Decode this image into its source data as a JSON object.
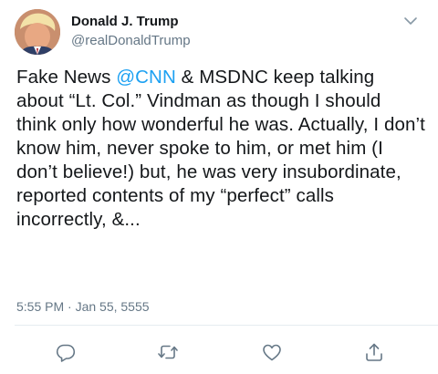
{
  "tweet": {
    "author": {
      "display_name": "Donald J. Trump",
      "handle": "@realDonaldTrump"
    },
    "text": {
      "part1": "Fake News ",
      "mention": "@CNN",
      "part2": " & MSDNC keep talking about “Lt. Col.” Vindman as though I should think only how wonderful he was. Actually, I don’t know him, never spoke to him, or met him (I don’t believe!) but, he was very insubordinate, reported contents of my “perfect” calls incorrectly, &..."
    },
    "timestamp": "5:55 PM · Jan 55, 5555"
  },
  "icons": {
    "caret": "chevron-down-icon",
    "reply": "reply-icon",
    "retweet": "retweet-icon",
    "like": "like-icon",
    "share": "share-icon"
  },
  "colors": {
    "text": "#14171a",
    "secondary": "#657786",
    "link": "#1da1f2",
    "divider": "#e6ecf0"
  }
}
